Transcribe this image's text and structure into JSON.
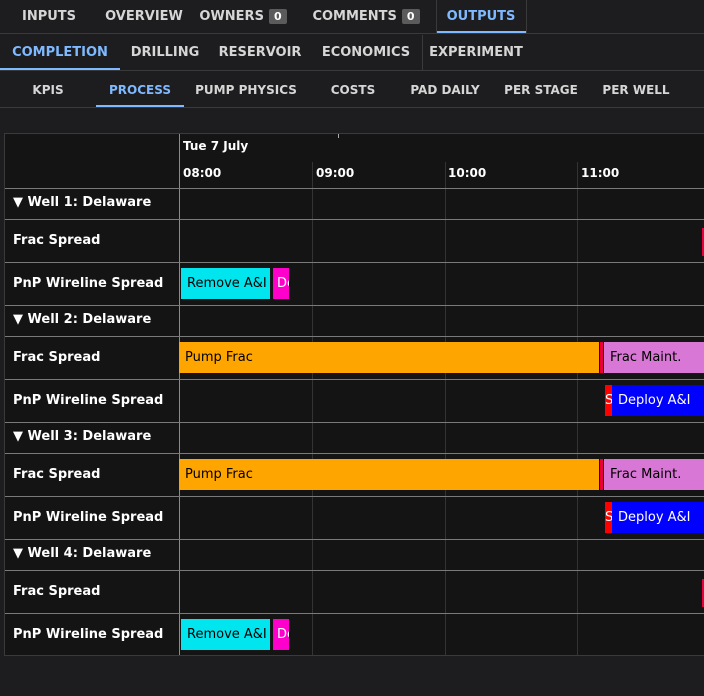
{
  "tabs_level1": [
    {
      "label": "INPUTS"
    },
    {
      "label": "OVERVIEW"
    },
    {
      "label": "OWNERS",
      "badge": "0"
    },
    {
      "label": "COMMENTS",
      "badge": "0"
    },
    {
      "label": "OUTPUTS",
      "active": true
    }
  ],
  "tabs_level2": [
    {
      "label": "COMPLETION",
      "active": true
    },
    {
      "label": "DRILLING"
    },
    {
      "label": "RESERVOIR"
    },
    {
      "label": "ECONOMICS"
    },
    {
      "label": "EXPERIMENT"
    }
  ],
  "tabs_level3": [
    {
      "label": "KPIS"
    },
    {
      "label": "PROCESS",
      "active": true
    },
    {
      "label": "PUMP PHYSICS"
    },
    {
      "label": "COSTS"
    },
    {
      "label": "PAD DAILY"
    },
    {
      "label": "PER STAGE"
    },
    {
      "label": "PER WELL"
    }
  ],
  "gantt": {
    "date": "Tue 7 July",
    "hours": [
      "08:00",
      "09:00",
      "10:00",
      "11:00"
    ],
    "rows": [
      {
        "label": "▼ Well 1: Delaware",
        "group": true
      },
      {
        "label": "Frac Spread",
        "bars": [
          {
            "text": "",
            "color": "#e8003a"
          }
        ]
      },
      {
        "label": "PnP Wireline Spread",
        "bars": [
          {
            "text": "Remove A&I",
            "color": "#00e5ee"
          },
          {
            "text": "De",
            "color": "#ff00cc"
          }
        ]
      },
      {
        "label": "▼ Well 2: Delaware",
        "group": true
      },
      {
        "label": "Frac Spread",
        "bars": [
          {
            "text": "Pump Frac",
            "color": "#ffa500"
          },
          {
            "text": "",
            "color": "#e8003a"
          },
          {
            "text": "Frac Maint.",
            "color": "#d877d6"
          }
        ]
      },
      {
        "label": "PnP Wireline Spread",
        "bars": [
          {
            "text": "S",
            "color": "#ff0000"
          },
          {
            "text": "Deploy A&I",
            "color": "#0000ff"
          }
        ]
      },
      {
        "label": "▼ Well 3: Delaware",
        "group": true
      },
      {
        "label": "Frac Spread",
        "bars": [
          {
            "text": "Pump Frac",
            "color": "#ffa500"
          },
          {
            "text": "",
            "color": "#e8003a"
          },
          {
            "text": "Frac Maint.",
            "color": "#d877d6"
          }
        ]
      },
      {
        "label": "PnP Wireline Spread",
        "bars": [
          {
            "text": "S",
            "color": "#ff0000"
          },
          {
            "text": "Deploy A&I",
            "color": "#0000ff"
          }
        ]
      },
      {
        "label": "▼ Well 4: Delaware",
        "group": true
      },
      {
        "label": "Frac Spread",
        "bars": [
          {
            "text": "",
            "color": "#e8003a"
          }
        ]
      },
      {
        "label": "PnP Wireline Spread",
        "bars": [
          {
            "text": "Remove A&I",
            "color": "#00e5ee"
          },
          {
            "text": "De",
            "color": "#ff00cc"
          }
        ]
      }
    ]
  }
}
